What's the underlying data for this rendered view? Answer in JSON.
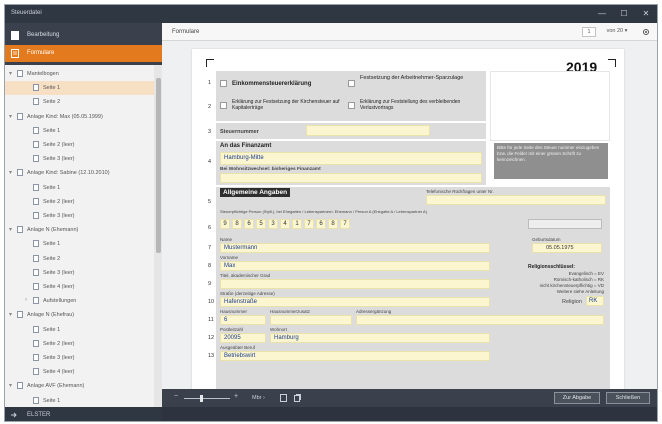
{
  "window": {
    "title": "Steuerdatei",
    "min": "—",
    "max": "☐",
    "close": "✕"
  },
  "nav": [
    {
      "label": "Bearbeitung",
      "active": false
    },
    {
      "label": "Formulare",
      "active": true
    }
  ],
  "tree": [
    {
      "label": "Mantelbogen",
      "level": 0,
      "chev": "▾"
    },
    {
      "label": "Seite 1",
      "level": 1,
      "selected": true
    },
    {
      "label": "Seite 2",
      "level": 1
    },
    {
      "label": "Anlage Kind: Max (05.05.1999)",
      "level": 0,
      "chev": "▾"
    },
    {
      "label": "Seite 1",
      "level": 1
    },
    {
      "label": "Seite 2 (leer)",
      "level": 1
    },
    {
      "label": "Seite 3 (leer)",
      "level": 1
    },
    {
      "label": "Anlage Kind: Sabine (12.10.2010)",
      "level": 0,
      "chev": "▾"
    },
    {
      "label": "Seite 1",
      "level": 1
    },
    {
      "label": "Seite 2 (leer)",
      "level": 1
    },
    {
      "label": "Seite 3 (leer)",
      "level": 1
    },
    {
      "label": "Anlage N (Ehemann)",
      "level": 0,
      "chev": "▾"
    },
    {
      "label": "Seite 1",
      "level": 1
    },
    {
      "label": "Seite 2",
      "level": 1
    },
    {
      "label": "Seite 3 (leer)",
      "level": 1
    },
    {
      "label": "Seite 4 (leer)",
      "level": 1
    },
    {
      "label": "Aufstellungen",
      "level": 1,
      "chev": "›"
    },
    {
      "label": "Anlage N (Ehefrau)",
      "level": 0,
      "chev": "▾"
    },
    {
      "label": "Seite 1",
      "level": 1
    },
    {
      "label": "Seite 2 (leer)",
      "level": 1
    },
    {
      "label": "Seite 3 (leer)",
      "level": 1
    },
    {
      "label": "Seite 4 (leer)",
      "level": 1
    },
    {
      "label": "Anlage AVF (Ehemann)",
      "level": 0,
      "chev": "▾"
    },
    {
      "label": "Seite 1",
      "level": 1
    }
  ],
  "user": {
    "label": "ELSTER"
  },
  "header": {
    "breadcrumb": "Formulare",
    "page_current": "1",
    "page_total": "von 20 ▾"
  },
  "form": {
    "year": "2019",
    "checkboxes": [
      "Einkommensteuererklärung",
      "Festsetzung der Arbeitnehmer-Sparzulage",
      "Erklärung zur Festsetzung der Kirchensteuer auf Kapitalerträge",
      "Erklärung zur Feststellung des verbleibenden Verlustvortrags"
    ],
    "steuernummer_label": "Steuernummer",
    "finanzamt_label": "An das Finanzamt",
    "finanzamt_value": "Hamburg-Mitte",
    "wohnsitz_label": "Bei Wohnsitzwechsel: bisheriges Finanzamt",
    "note": "Bitte für jede Seite den Steuer nummer einzugeben bzw. die Felder mit einer grünen Schrift zu kennzeichnen.",
    "section_title": "Allgemeine Angaben",
    "telefon_label": "Telefonische Rückfragen unter Nr.",
    "idnr_label": "Steuerpflichtige Person (Stpfl.), bei Ehegatten / Lebenspartnern: Ehemann / Person A (Ehegatte A / Lebenspartner A)",
    "idnr_digits": [
      "9",
      "8",
      "6",
      "5",
      "3",
      "4",
      "1",
      "7",
      "6",
      "8",
      "7"
    ],
    "name_label": "Name",
    "name_value": "Mustermann",
    "birth_label": "Geburtsdatum",
    "birth_value": "05.05.1975",
    "vorname_label": "Vorname",
    "vorname_value": "Max",
    "titel_label": "Titel, akademischer Grad",
    "religion_title": "Religionsschlüssel:",
    "religion_lines": [
      "Evangelisch = EV",
      "Römisch-katholisch = RK",
      "nicht kirchensteuerpflichtig = VD",
      "Weitere siehe Anleitung"
    ],
    "strasse_label": "Straße (derzeitige Adresse)",
    "strasse_value": "Hafenstraße",
    "religion_label": "Religion",
    "religion_value": "RK",
    "hausnr_label": "Hausnummer",
    "zusatz_label": "Hausnummerzusatz",
    "adress_label": "Adressergänzung",
    "hausnr_value": "6",
    "plz_label": "Postleitzahl",
    "plz_value": "20095",
    "ort_label": "Wohnort",
    "ort_value": "Hamburg",
    "beruf_label": "Ausgeübter Beruf",
    "beruf_value": "Betriebswirt",
    "rows": [
      "1",
      "2",
      "3",
      "4",
      "5",
      "6",
      "7",
      "8",
      "9",
      "10",
      "11",
      "12",
      "13",
      "14"
    ]
  },
  "footer": {
    "minus": "−",
    "plus": "+",
    "zoom": "Mbr ›",
    "btn_primary": "Zur Abgabe",
    "btn_secondary": "Schließen"
  },
  "colors": {
    "accent": "#e37a1e",
    "field": "#fbf6cf",
    "dark": "#2d3440"
  }
}
